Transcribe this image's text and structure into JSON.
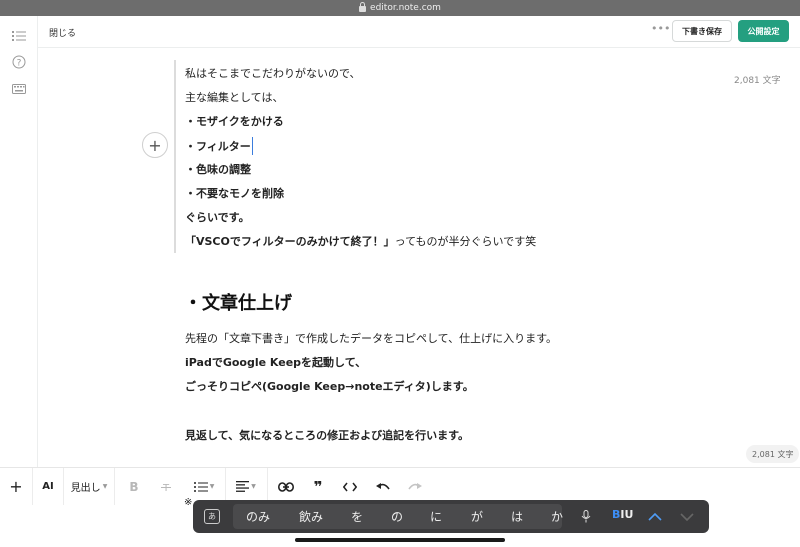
{
  "browser": {
    "url": "editor.note.com"
  },
  "header": {
    "close_label": "閉じる",
    "more_label": "•••",
    "draft_label": "下書き保存",
    "publish_label": "公開設定"
  },
  "editor": {
    "word_count_top": "2,081 文字",
    "word_count_badge": "2,081 文字",
    "quote_lines": [
      "私はそこまでこだわりがないので、",
      "主な編集としては、",
      "・モザイクをかける",
      "・フィルター",
      "・色味の調整",
      "・不要なモノを削除",
      "ぐらいです。"
    ],
    "quote_last_bold": "「VSCOでフィルターのみかけて終了！」",
    "quote_last_rest": "ってものが半分ぐらいです笑",
    "heading": "・文章仕上げ",
    "body_lines": [
      "先程の「文章下書き」で作成したデータをコピペして、仕上げに入ります。",
      "iPadでGoogle Keepを起動して、",
      "ごっそりコピペ(Google Keep→noteエディタ)します。",
      "見返して、気になるところの修正および追記を行います。"
    ],
    "partial_line": "※"
  },
  "toolbar": {
    "ai_label": "AI",
    "heading_label": "見出し",
    "bold_label": "B",
    "plus_label": "+"
  },
  "keyboard": {
    "ime_label": "あ",
    "suggestions": [
      "のみ",
      "飲み",
      "を",
      "の",
      "に",
      "が",
      "は",
      "か"
    ],
    "biu_b": "B",
    "biu_rest": "IU"
  },
  "colors": {
    "accent": "#249f80",
    "caret": "#3b7ddd"
  }
}
